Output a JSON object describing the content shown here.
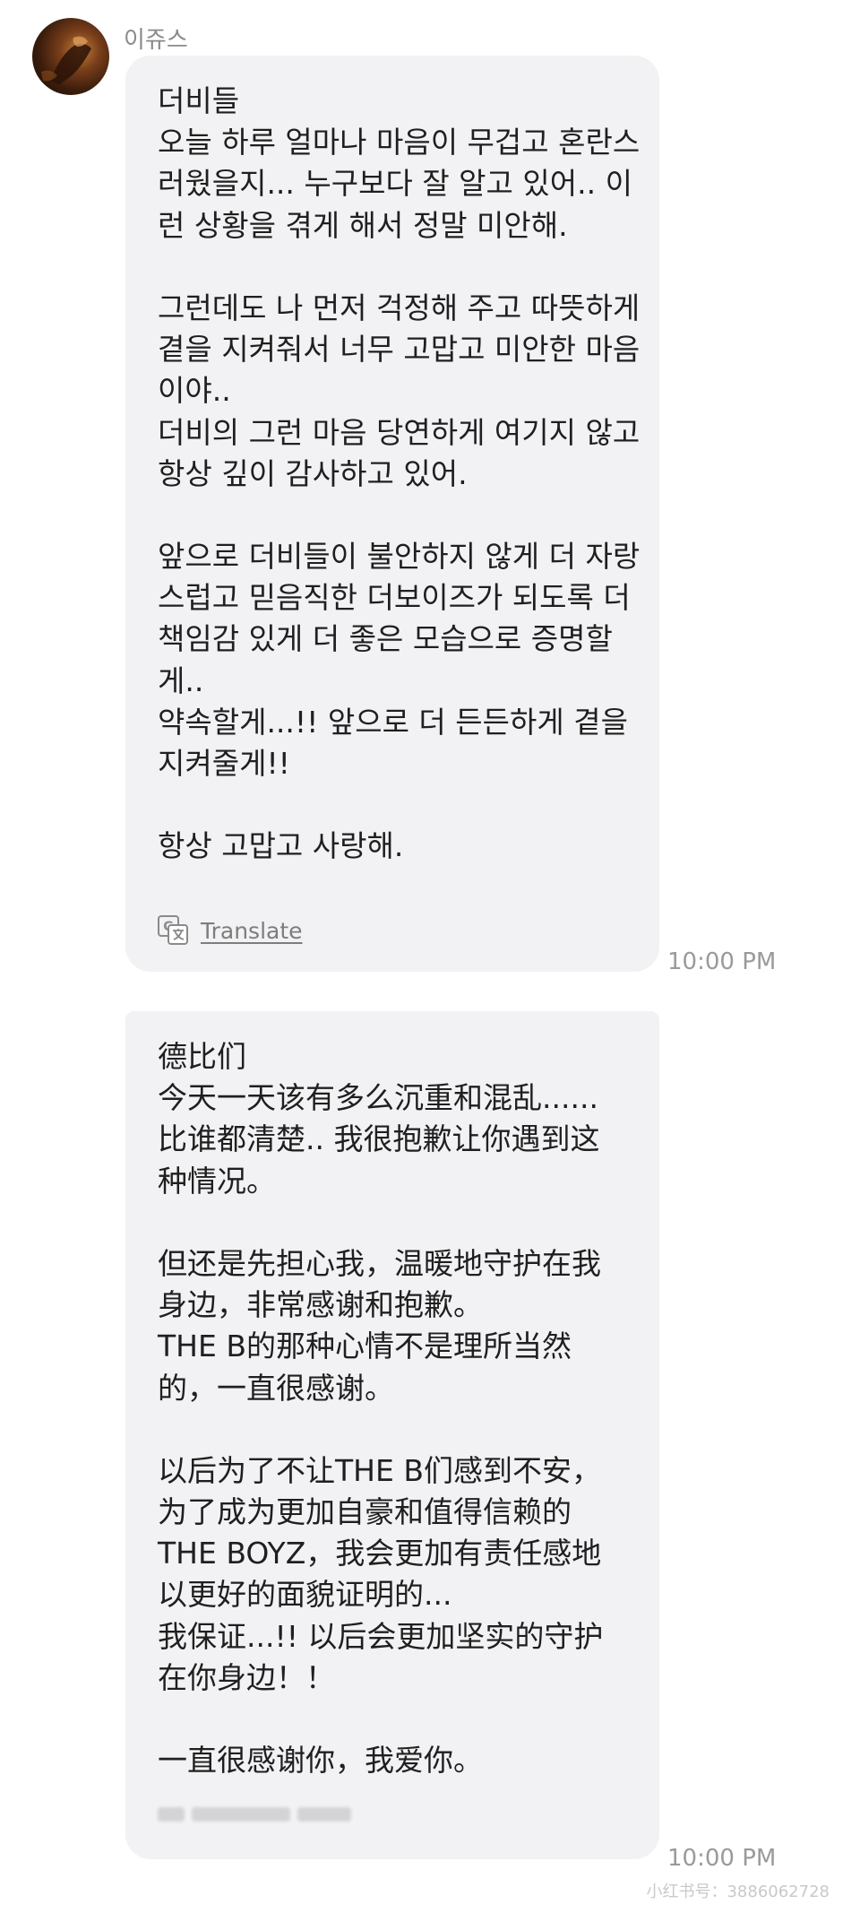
{
  "sender": {
    "name": "이쥬스",
    "avatar_icon": "profile-photo-icon"
  },
  "messages": [
    {
      "lines": [
        "더비들",
        "오늘 하루 얼마나 마음이 무겁고 혼란스",
        "러웠을지... 누구보다 잘 알고 있어.. 이",
        "런 상황을 겪게 해서 정말 미안해.",
        "",
        "그런데도 나 먼저 걱정해 주고 따뜻하게",
        "곁을 지켜줘서 너무 고맙고 미안한 마음",
        "이야..",
        "더비의 그런 마음 당연하게 여기지 않고",
        "항상 깊이 감사하고 있어.",
        "",
        "앞으로 더비들이 불안하지 않게 더 자랑",
        "스럽고 믿음직한 더보이즈가 되도록 더",
        "책임감 있게 더 좋은 모습으로 증명할",
        "게..",
        "약속할게...!! 앞으로 더 든든하게 곁을",
        "지켜줄게!!",
        "",
        "항상 고맙고 사랑해."
      ],
      "translate_label": "Translate",
      "translate_icon": "google-translate-icon",
      "time": "10:00 PM"
    },
    {
      "lines": [
        "德比们",
        "今天一天该有多么沉重和混乱......",
        "比谁都清楚.. 我很抱歉让你遇到这",
        "种情况。",
        "",
        "但还是先担心我，温暖地守护在我",
        "身边，非常感谢和抱歉。",
        "THE B的那种心情不是理所当然",
        "的，一直很感谢。",
        "",
        "以后为了不让THE B们感到不安，",
        "为了成为更加自豪和值得信赖的",
        "THE BOYZ，我会更加有责任感地",
        "以更好的面貌证明的...",
        "我保证...!! 以后会更加坚实的守护",
        "在你身边！！",
        "",
        "一直很感谢你，我爱你。"
      ],
      "time": "10:00 PM"
    }
  ],
  "watermark": "小红书号：3886062728"
}
